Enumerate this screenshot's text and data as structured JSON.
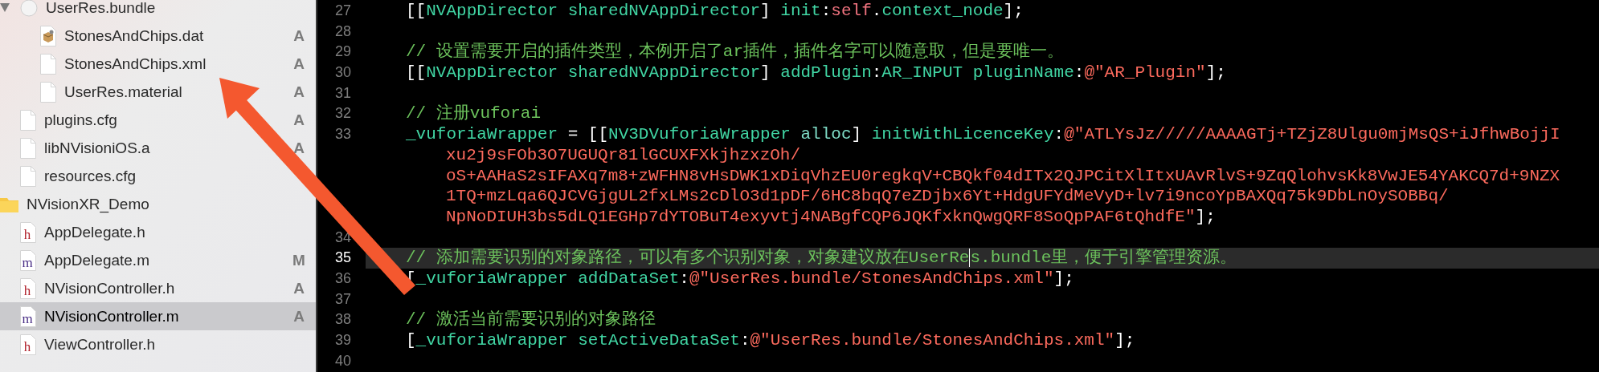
{
  "sidebar": {
    "tree": [
      {
        "children": [
          {
            "name": "UserRes.bundle",
            "kind": "bundle",
            "expanded": true,
            "selected": false,
            "children": [
              {
                "name": "StonesAndChips.dat",
                "kind": "dat",
                "status": "A",
                "selected": false
              },
              {
                "name": "StonesAndChips.xml",
                "kind": "file",
                "status": "A",
                "selected": false
              },
              {
                "name": "UserRes.material",
                "kind": "file",
                "status": "A",
                "selected": false
              }
            ]
          },
          {
            "name": "plugins.cfg",
            "kind": "file",
            "status": "A",
            "selected": false
          },
          {
            "name": "libNVisioniOS.a",
            "kind": "file",
            "status": "A",
            "selected": false
          },
          {
            "name": "resources.cfg",
            "kind": "file",
            "selected": false
          }
        ]
      },
      {
        "name": "NVisionXR_Demo",
        "kind": "folder",
        "selected": false,
        "children": [
          {
            "name": "AppDelegate.h",
            "kind": "header",
            "icon_letter": "h",
            "selected": false
          },
          {
            "name": "AppDelegate.m",
            "kind": "source",
            "icon_letter": "m",
            "status": "M",
            "selected": false
          },
          {
            "name": "NVisionController.h",
            "kind": "header",
            "icon_letter": "h",
            "status": "A",
            "selected": false
          },
          {
            "name": "NVisionController.m",
            "kind": "source",
            "icon_letter": "m",
            "status": "A",
            "selected": true
          },
          {
            "name": "ViewController.h",
            "kind": "header",
            "icon_letter": "h",
            "selected": false
          }
        ]
      }
    ]
  },
  "editor": {
    "lines": [
      {
        "number": "27",
        "current": false,
        "tokens": [
          {
            "t": "[[",
            "kind": "plain"
          },
          {
            "t": "NVAppDirector",
            "kind": "symbol"
          },
          {
            "t": " sharedNVAppDirector",
            "kind": "symbol"
          },
          {
            "t": "] ",
            "kind": "plain"
          },
          {
            "t": "init",
            "kind": "symbol"
          },
          {
            "t": ":",
            "kind": "plain"
          },
          {
            "t": "self",
            "kind": "keyword"
          },
          {
            "t": ".",
            "kind": "plain"
          },
          {
            "t": "context_node",
            "kind": "symbol"
          },
          {
            "t": "];",
            "kind": "plain"
          }
        ]
      },
      {
        "number": "28",
        "current": false
      },
      {
        "number": "29",
        "current": false,
        "tokens": [
          {
            "t": "// 设置需要开启的插件类型，本例开启了ar插件，插件名字可以随意取，但是要唯一。",
            "kind": "comment"
          }
        ]
      },
      {
        "number": "30",
        "current": false,
        "tokens": [
          {
            "t": "[[",
            "kind": "plain"
          },
          {
            "t": "NVAppDirector",
            "kind": "symbol"
          },
          {
            "t": " sharedNVAppDirector",
            "kind": "symbol"
          },
          {
            "t": "] ",
            "kind": "plain"
          },
          {
            "t": "addPlugin",
            "kind": "symbol"
          },
          {
            "t": ":",
            "kind": "plain"
          },
          {
            "t": "AR_INPUT pluginName",
            "kind": "symbol"
          },
          {
            "t": ":",
            "kind": "plain"
          },
          {
            "t": "@\"AR_Plugin\"",
            "kind": "string"
          },
          {
            "t": "];",
            "kind": "plain"
          }
        ]
      },
      {
        "number": "31",
        "current": false
      },
      {
        "number": "32",
        "current": false,
        "tokens": [
          {
            "t": "// 注册vuforai",
            "kind": "comment"
          }
        ]
      },
      {
        "number": "33",
        "current": false,
        "tokens": [
          {
            "t": "_vuforiaWrapper",
            "kind": "symbol"
          },
          {
            "t": " = [[",
            "kind": "plain"
          },
          {
            "t": "NV3DVuforiaWrapper",
            "kind": "symbol"
          },
          {
            "t": " alloc",
            "kind": "system"
          },
          {
            "t": "] ",
            "kind": "plain"
          },
          {
            "t": "initWithLicenceKey",
            "kind": "symbol"
          },
          {
            "t": ":",
            "kind": "plain"
          },
          {
            "t": "@\"ATLYsJz/////AAAAGTj+TZjZ8Ulgu0mjMsQS+iJfhwBojjI",
            "kind": "string"
          }
        ],
        "continuation": [
          {
            "tokens": [
              {
                "t": "xu2j9sFOb3O7UGUQr81lGCUXFXkjhzxzOh/",
                "kind": "string"
              }
            ]
          },
          {
            "tokens": [
              {
                "t": "oS+AAHaS2sIFAXq7m8+zWFHN8vHsDWK1xDiqVhzEU0regkqV+CBQkf04dITx2QJPCitXlItxUAvRlvS+9ZqQlohvsKk8VwJE54YAKCQ7d+9NZX",
                "kind": "string"
              }
            ]
          },
          {
            "tokens": [
              {
                "t": "1TQ+mzLqa6QJCVGjgUL2fxLMs2cDlO3d1pDF/6HC8bqQ7eZDjbx6Yt+HdgUFYdMeVyD+lv7i9ncoYpBAXQq75k9DbLnOySOBBq/",
                "kind": "string"
              }
            ]
          },
          {
            "tokens": [
              {
                "t": "NpNoDIUH3bs5dLQ1EGHp7dYTOBuT4exyvtj4NABgfCQP6JQKfxknQwgQRF8SoQpPAF6tQhdfE\"",
                "kind": "string"
              },
              {
                "t": "];",
                "kind": "plain"
              }
            ]
          }
        ]
      },
      {
        "number": "34",
        "current": false
      },
      {
        "number": "35",
        "current": true,
        "tokens": [
          {
            "t": "// 添加需要识别的对象路径，可以有多个识别对象，对象建议放在UserRe",
            "kind": "comment"
          },
          {
            "t": "s.bundle里，便于引擎管理资源。",
            "kind": "comment",
            "cursor_before": true
          }
        ]
      },
      {
        "number": "36",
        "current": false,
        "tokens": [
          {
            "t": "[",
            "kind": "plain"
          },
          {
            "t": "_vuforiaWrapper",
            "kind": "symbol"
          },
          {
            "t": " addDataSet",
            "kind": "symbol"
          },
          {
            "t": ":",
            "kind": "plain"
          },
          {
            "t": "@\"UserRes.bundle/StonesAndChips.xml\"",
            "kind": "string"
          },
          {
            "t": "];",
            "kind": "plain"
          }
        ]
      },
      {
        "number": "37",
        "current": false
      },
      {
        "number": "38",
        "current": false,
        "tokens": [
          {
            "t": "// 激活当前需要识别的对象路径",
            "kind": "comment"
          }
        ]
      },
      {
        "number": "39",
        "current": false,
        "tokens": [
          {
            "t": "[",
            "kind": "plain"
          },
          {
            "t": "_vuforiaWrapper",
            "kind": "symbol"
          },
          {
            "t": " setActiveDataSet",
            "kind": "symbol"
          },
          {
            "t": ":",
            "kind": "plain"
          },
          {
            "t": "@\"UserRes.bundle/StonesAndChips.xml\"",
            "kind": "string"
          },
          {
            "t": "];",
            "kind": "plain"
          }
        ]
      },
      {
        "number": "40",
        "current": false
      }
    ]
  }
}
